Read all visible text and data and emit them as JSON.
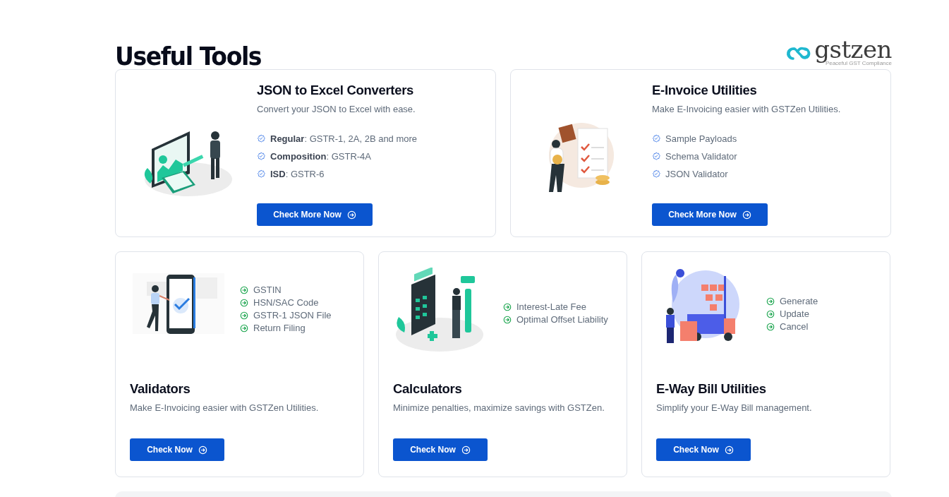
{
  "heading": "Useful Tools",
  "logo": {
    "name": "gstzen",
    "tagline": "Peaceful GST Compliance"
  },
  "cards": [
    {
      "kind": "wide",
      "title": "JSON to Excel Converters",
      "subtitle": "Convert your JSON to Excel with ease.",
      "items": [
        "**Regular**: GSTR-1, 2A, 2B and more",
        "**Composition**: GSTR-4A",
        "**ISD**: GSTR-6"
      ],
      "button": "Check More Now"
    },
    {
      "kind": "wide",
      "title": "E-Invoice Utilities",
      "subtitle": "Make E-Invoicing easier with GSTZen Utilities.",
      "items": [
        "Sample Payloads",
        "Schema Validator",
        "JSON Validator"
      ],
      "button": "Check More Now"
    },
    {
      "kind": "compact",
      "title": "Validators",
      "subtitle": "Make E-Invoicing easier with GSTZen Utilities.",
      "items": [
        "GSTIN",
        "HSN/SAC Code",
        "GSTR-1 JSON File",
        "Return Filing"
      ],
      "button": "Check Now"
    },
    {
      "kind": "compact",
      "title": "Calculators",
      "subtitle": "Minimize penalties, maximize savings with GSTZen.",
      "items": [
        "Interest-Late Fee",
        "Optimal Offset Liability"
      ],
      "button": "Check Now"
    },
    {
      "kind": "compact",
      "title": "E-Way Bill Utilities",
      "subtitle": "Simplify your E-Way Bill management.",
      "items": [
        "Generate",
        "Update",
        "Cancel"
      ],
      "button": "Check Now"
    }
  ]
}
